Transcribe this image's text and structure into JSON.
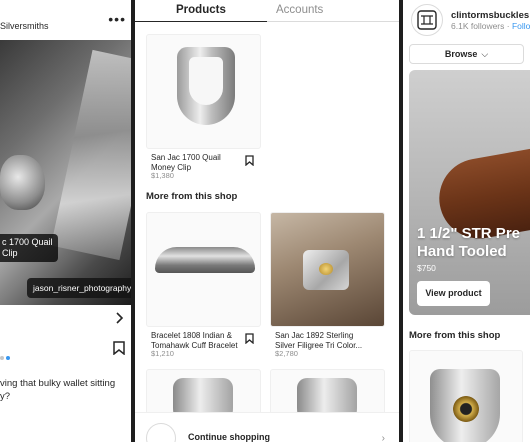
{
  "panel1": {
    "brand_partial": "Silversmiths",
    "more_icon": "more-dots-icon",
    "product_tag": "c 1700 Quail\nClip",
    "photo_credit": "jason_risner_photography",
    "caption": "ving that bulky wallet sitting\ny?",
    "colors": {
      "dot_active": "#3897f0",
      "dot_inactive": "#c7c7c7"
    }
  },
  "panel2": {
    "tabs": [
      {
        "label": "Products",
        "active": true
      },
      {
        "label": "Accounts",
        "active": false
      }
    ],
    "top_product": {
      "name": "San Jac 1700 Quail\nMoney Clip",
      "price": "$1,380"
    },
    "section_title": "More from this shop",
    "grid": [
      {
        "name": "Bracelet 1808 Indian &\nTomahawk Cuff Bracelet",
        "price": "$1,210"
      },
      {
        "name": "San Jac 1892 Sterling\nSilver Filigree Tri Color...",
        "price": "$2,780"
      }
    ],
    "continue_label": "Continue shopping"
  },
  "panel3": {
    "handle": "clintormsbuckles",
    "followers": "6.1K followers",
    "follow_partial": "Follo",
    "browse_label": "Browse",
    "hero": {
      "title_line1": "1 1/2\" STR Pre",
      "title_line2": "Hand Tooled",
      "price": "$750",
      "cta": "View product"
    },
    "section_title": "More from this shop"
  }
}
